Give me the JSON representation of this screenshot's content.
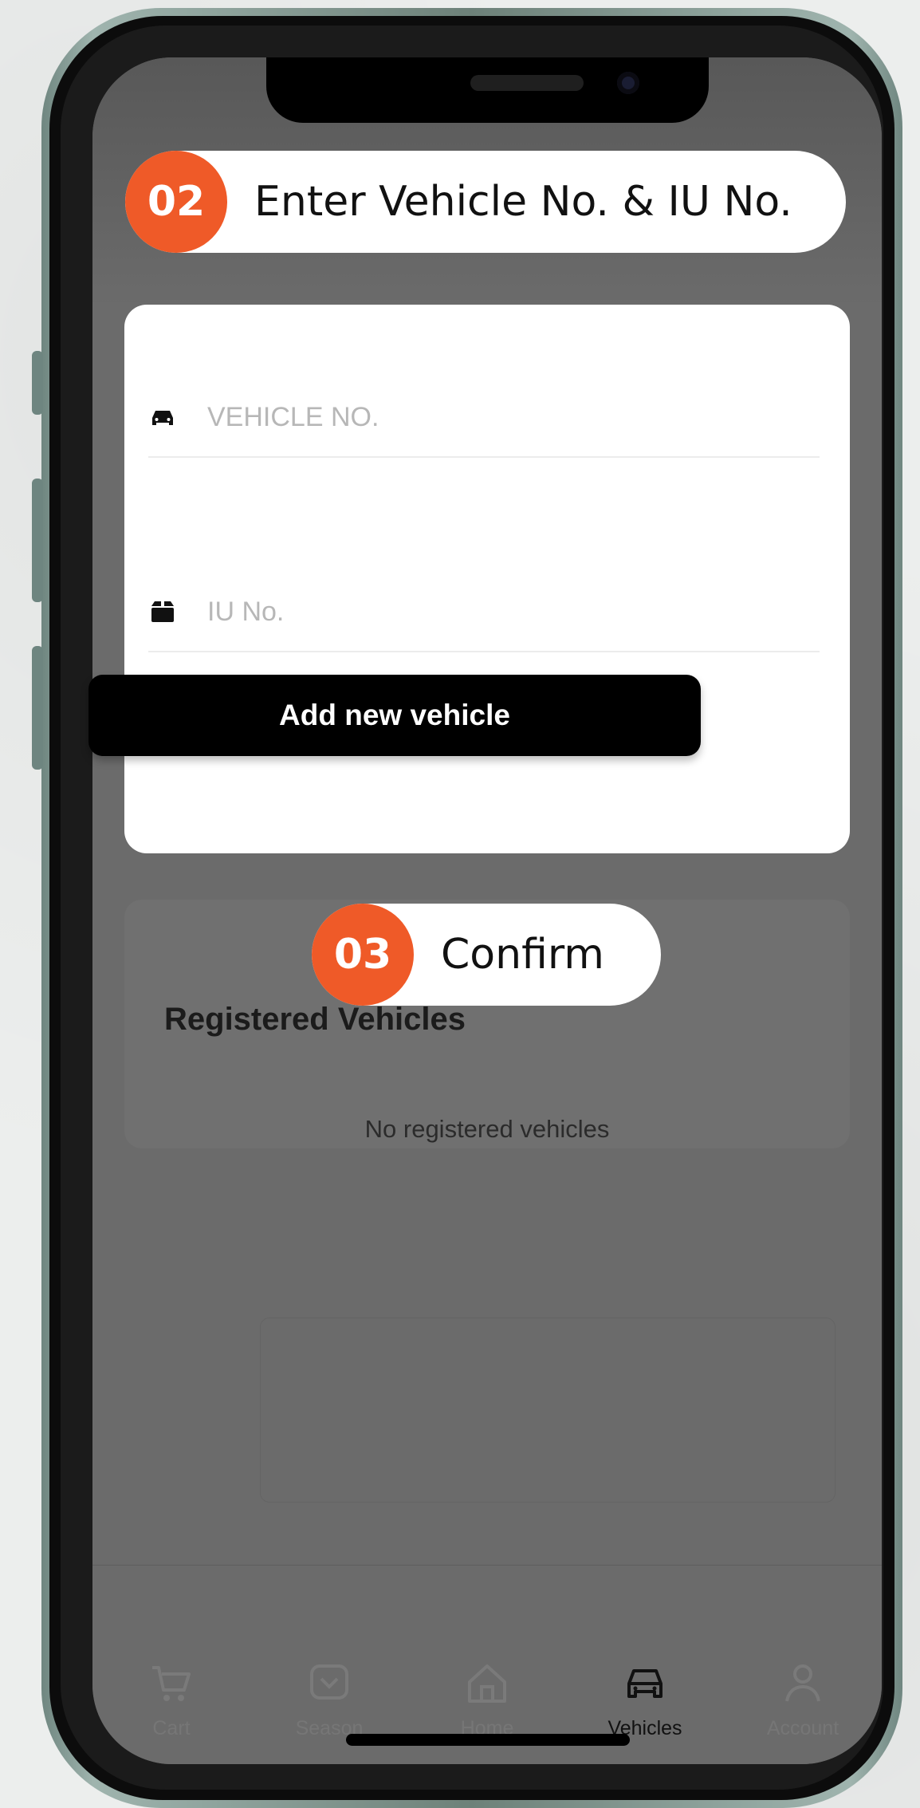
{
  "form": {
    "vehicle_placeholder": "VEHICLE NO.",
    "iu_placeholder": "IU No.",
    "add_button_label": "Add new vehicle"
  },
  "registered": {
    "title": "Registered Vehicles",
    "empty_message": "No registered vehicles"
  },
  "callouts": [
    {
      "number": "02",
      "text": "Enter Vehicle No. & IU No."
    },
    {
      "number": "03",
      "text": "Confirm"
    }
  ],
  "bottom_nav": {
    "items": [
      {
        "label": "Cart",
        "icon": "cart-icon",
        "active": false
      },
      {
        "label": "Season",
        "icon": "season-icon",
        "active": false
      },
      {
        "label": "Home",
        "icon": "home-icon",
        "active": false
      },
      {
        "label": "Vehicles",
        "icon": "car-icon",
        "active": true
      },
      {
        "label": "Account",
        "icon": "account-icon",
        "active": false
      }
    ]
  },
  "colors": {
    "accent": "#ef5a28",
    "overlay": "#6b6b6b",
    "button": "#000000"
  }
}
